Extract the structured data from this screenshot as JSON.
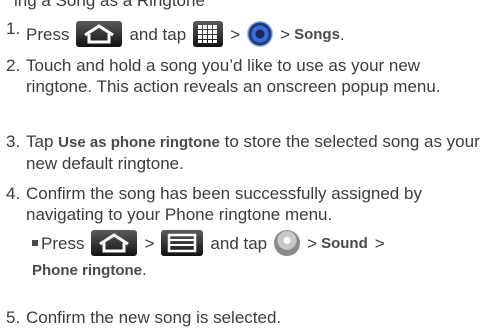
{
  "header_fragment": "ing a Song as a Ringtone",
  "steps": [
    {
      "num": "1.",
      "parts": [
        "Press",
        "and tap",
        ">",
        ">",
        "Songs",
        "."
      ]
    },
    {
      "num": "2.",
      "text": "Touch and hold a song you’d like to use as your new ringtone. This action reveals an onscreen popup menu."
    },
    {
      "num": "3.",
      "pre": "Tap",
      "bold": "Use as phone ringtone",
      "post": "to store the selected song as your new default ringtone."
    },
    {
      "num": "4.",
      "text": "Confirm the song has been successfully assigned by navigating to your Phone ringtone menu.",
      "sub": [
        "Press",
        ">",
        "and tap",
        ">",
        "Sound",
        ">",
        "Phone ringtone",
        "."
      ]
    },
    {
      "num": "5.",
      "text": "Confirm the new song is selected."
    }
  ],
  "icons": {
    "home": "home-icon",
    "apps": "apps-grid-icon",
    "music": "music-player-icon",
    "menu": "menu-icon",
    "settings": "settings-icon"
  }
}
